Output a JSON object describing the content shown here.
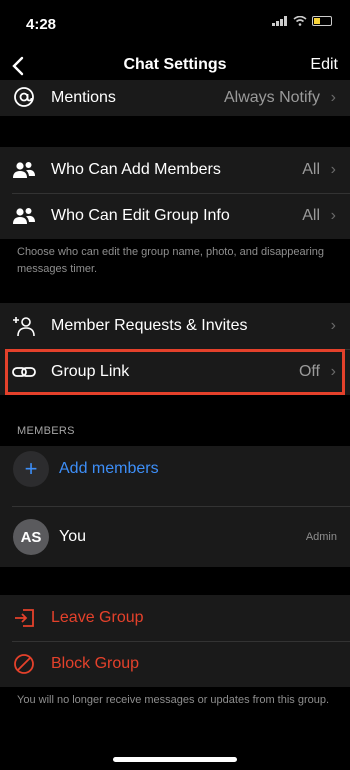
{
  "status_bar": {
    "time": "4:28"
  },
  "nav": {
    "title": "Chat Settings",
    "edit_label": "Edit",
    "back_glyph": "‹"
  },
  "mentions": {
    "label": "Mentions",
    "value": "Always Notify"
  },
  "permissions": {
    "rows": [
      {
        "label": "Who Can Add Members",
        "value": "All"
      },
      {
        "label": "Who Can Edit Group Info",
        "value": "All"
      }
    ],
    "footnote": "Choose who can edit the group name, photo, and disappearing messages timer."
  },
  "links": {
    "member_requests_label": "Member Requests & Invites",
    "group_link_label": "Group Link",
    "group_link_value": "Off"
  },
  "members": {
    "header": "MEMBERS",
    "add_label": "Add members",
    "you": {
      "initials": "AS",
      "name": "You",
      "role": "Admin"
    }
  },
  "danger": {
    "leave_label": "Leave Group",
    "block_label": "Block Group",
    "footnote": "You will no longer receive messages or updates from this group."
  },
  "colors": {
    "accent": "#3d8ef7",
    "danger": "#e4412b",
    "highlight": "#e4412b"
  },
  "icons": {
    "mentions": "at-sign-icon",
    "add_members": "people-icon",
    "edit_info": "people-icon",
    "member_requests": "person-add-icon",
    "group_link": "link-icon",
    "leave": "leave-icon",
    "block": "block-icon"
  }
}
